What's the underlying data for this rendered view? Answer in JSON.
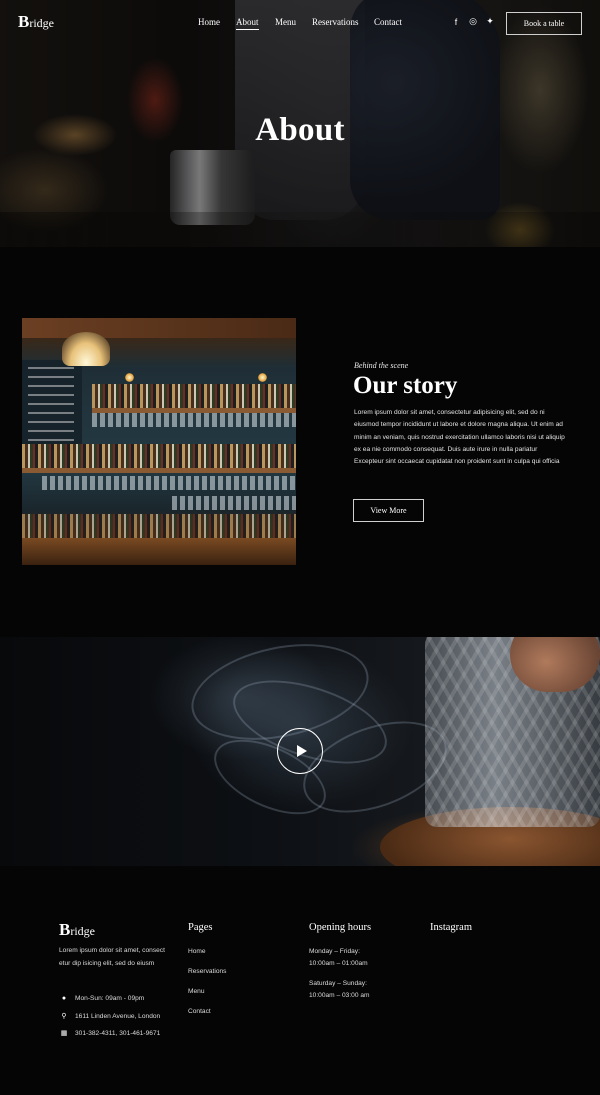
{
  "brand": {
    "initial": "B",
    "rest": "ridge"
  },
  "nav": {
    "items": [
      "Home",
      "About",
      "Menu",
      "Reservations",
      "Contact"
    ],
    "active": "About"
  },
  "social": [
    {
      "name": "facebook-icon",
      "glyph": "f"
    },
    {
      "name": "instagram-icon",
      "glyph": "◎"
    },
    {
      "name": "twitter-icon",
      "glyph": "✦"
    }
  ],
  "book_button": "Book a table",
  "hero": {
    "title": "About"
  },
  "story": {
    "eyebrow": "Behind the scene",
    "title": "Our story",
    "text": "Lorem ipsum dolor sit amet, consectetur adipisicing elit, sed do ni eiusmod tempor incididunt ut labore et dolore magna aliqua. Ut enim ad minim an veniam, quis nostrud exercitation ullamco laboris nisi ut aliquip ex ea nie commodo consequat. Duis aute irure in nulla pariatur Excepteur sint occaecat cupidatat non proident sunt in culpa qui officia",
    "button": "View More"
  },
  "footer": {
    "description": "Lorem ipsum dolor sit amet, consect etur dip isicing elit, sed do eiusm",
    "contacts": [
      {
        "icon": "clock-icon",
        "glyph": "●",
        "text": "Mon-Sun: 09am - 09pm"
      },
      {
        "icon": "location-pin-icon",
        "glyph": "⚲",
        "text": "1611 Linden Avenue, London"
      },
      {
        "icon": "phone-icon",
        "glyph": "▦",
        "text": "301-382-4311, 301-461-9671"
      }
    ],
    "pages_title": "Pages",
    "pages": [
      "Home",
      "Reservations",
      "Menu",
      "Contact"
    ],
    "hours_title": "Opening hours",
    "hours": [
      {
        "days": "Monday – Friday:",
        "time": "10:00am – 01:00am"
      },
      {
        "days": "Saturday – Sunday:",
        "time": "10:00am – 03:00 am"
      }
    ],
    "instagram_title": "Instagram"
  }
}
